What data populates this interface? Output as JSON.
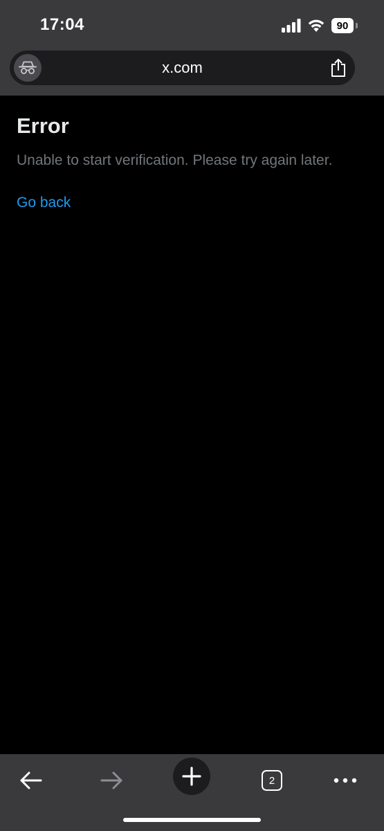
{
  "status_bar": {
    "time": "17:04",
    "battery_level": "90",
    "signal_icon": "cellular-signal-icon",
    "wifi_icon": "wifi-icon"
  },
  "url_bar": {
    "url": "x.com",
    "mode_icon": "incognito-icon",
    "share_icon": "share-icon"
  },
  "page": {
    "title": "Error",
    "message": "Unable to start verification. Please try again later.",
    "go_back_label": "Go back"
  },
  "toolbar": {
    "back_icon": "back-arrow-icon",
    "forward_icon": "forward-arrow-icon",
    "new_tab_icon": "plus-icon",
    "tab_count": "2",
    "menu_icon": "more-dots-icon"
  },
  "colors": {
    "chrome_background": "#3a3a3c",
    "page_background": "#000000",
    "title_text": "#e7e9ea",
    "message_text": "#71767b",
    "link": "#1d9bf0"
  }
}
